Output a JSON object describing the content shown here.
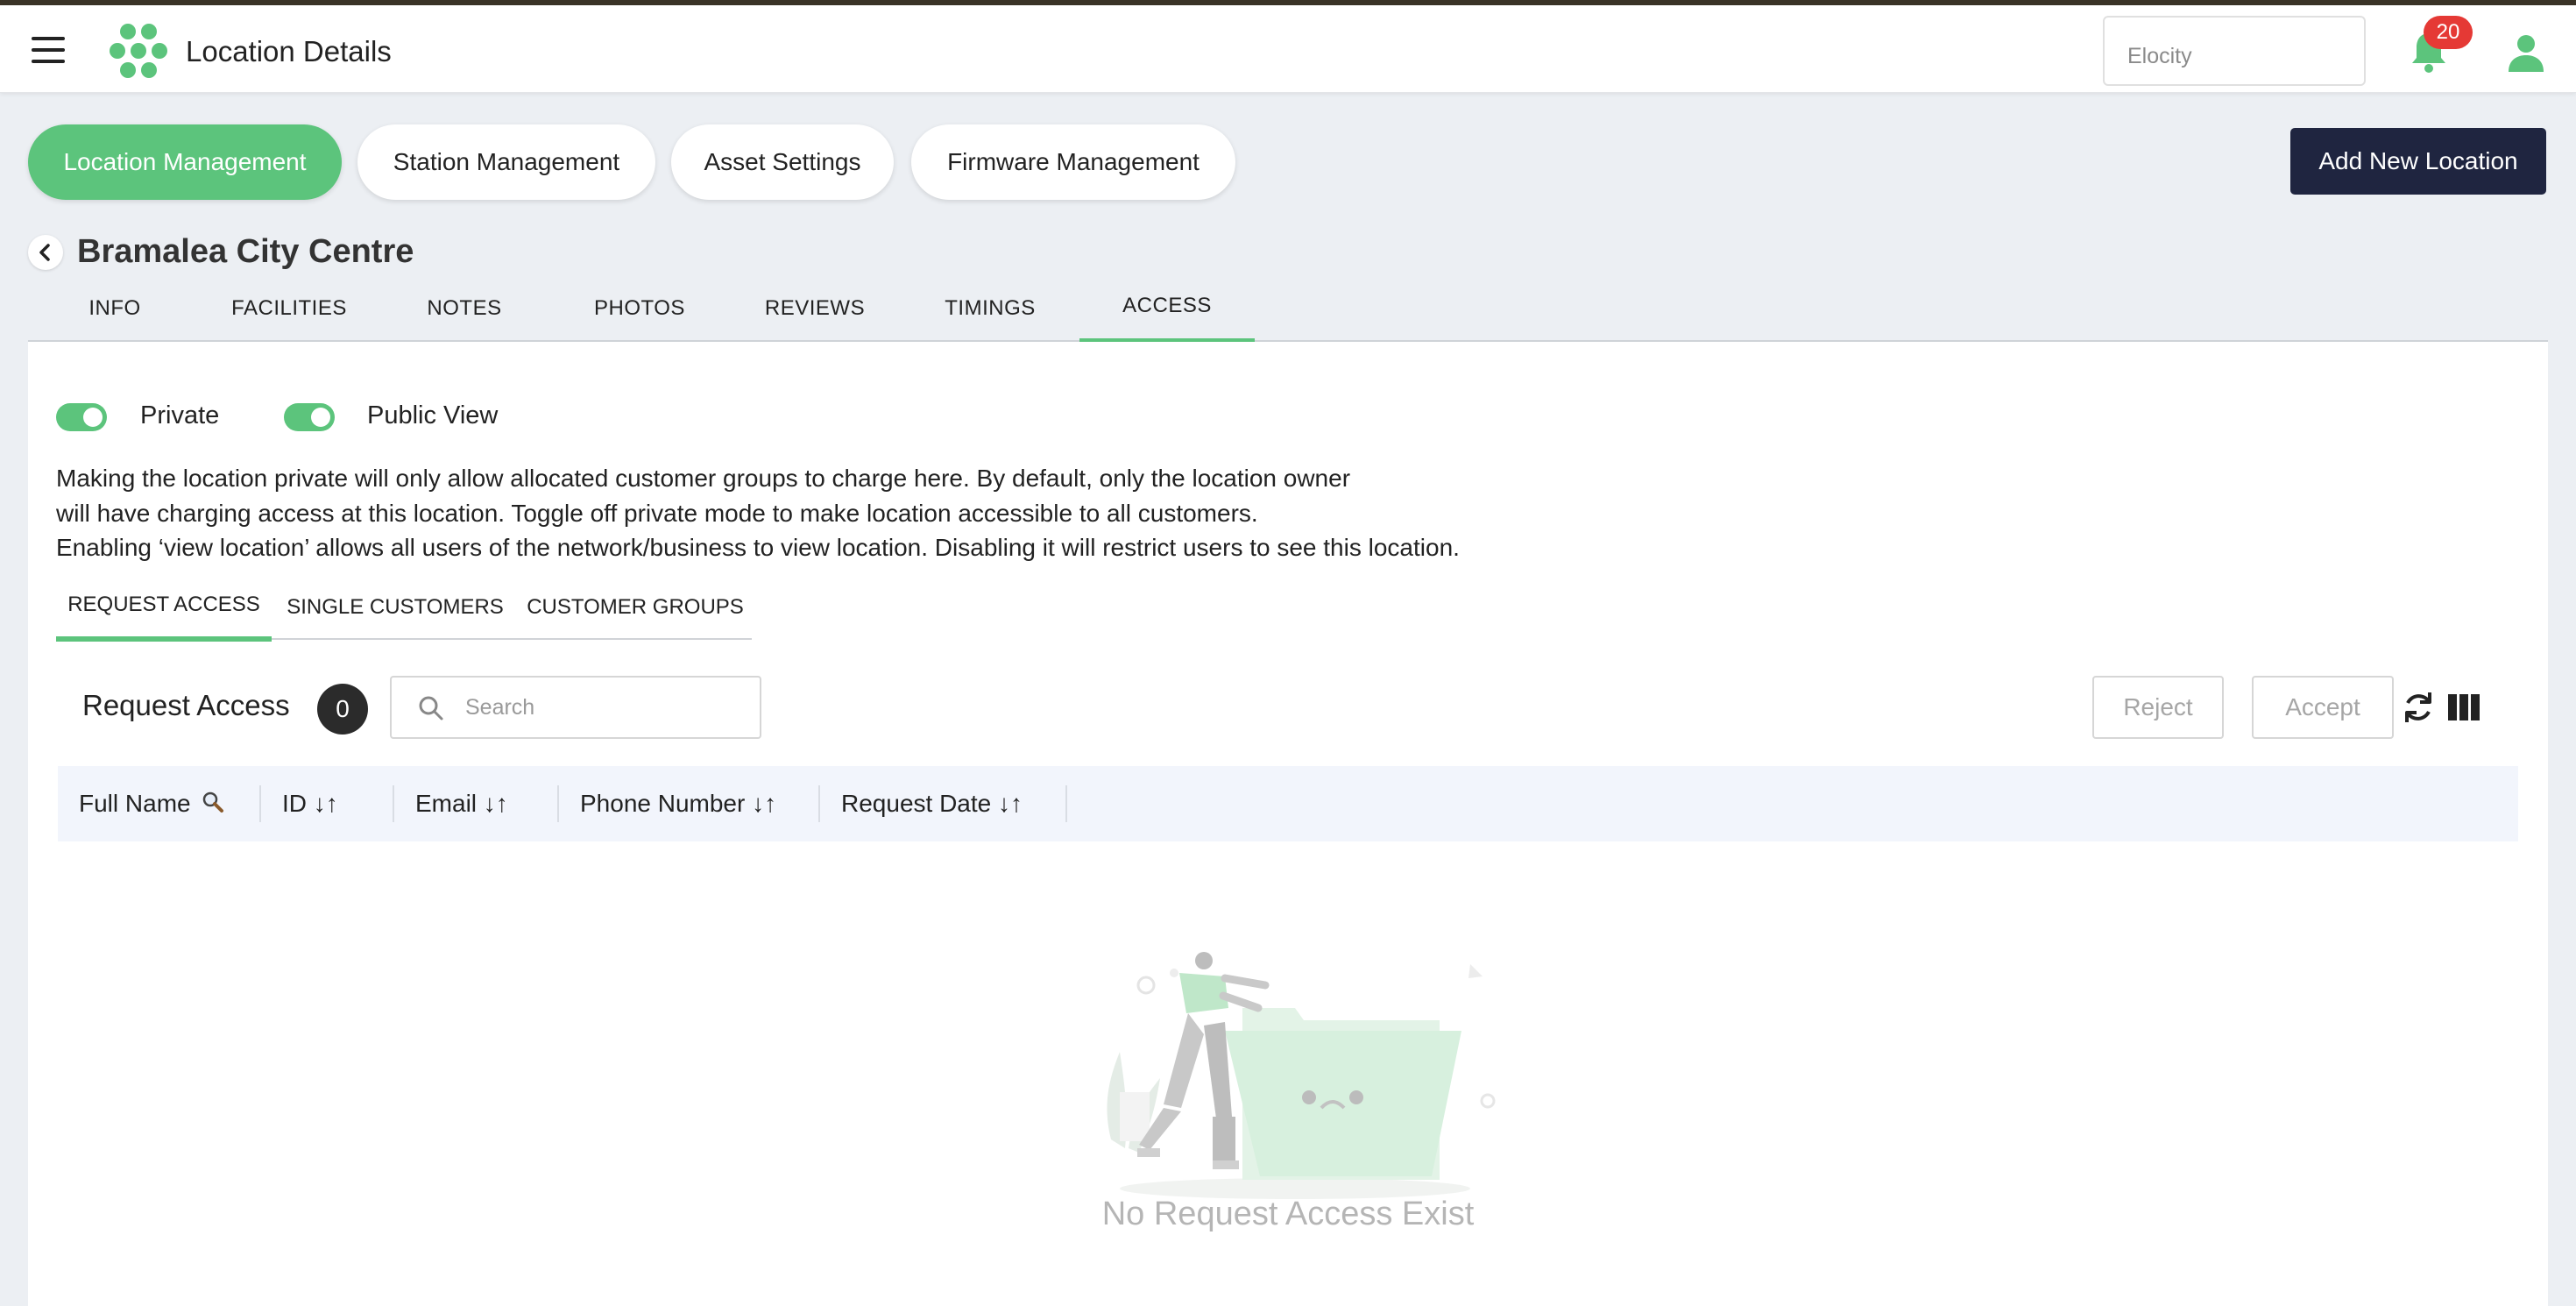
{
  "app": {
    "title": "Location Details",
    "org": "Elocity",
    "notifications": "20"
  },
  "nav_pills": [
    {
      "label": "Location Management",
      "active": true
    },
    {
      "label": "Station Management",
      "active": false
    },
    {
      "label": "Asset Settings",
      "active": false
    },
    {
      "label": "Firmware Management",
      "active": false
    }
  ],
  "add_button": "Add New Location",
  "location_name": "Bramalea City Centre",
  "tabs": [
    "INFO",
    "FACILITIES",
    "NOTES",
    "PHOTOS",
    "REVIEWS",
    "TIMINGS",
    "ACCESS"
  ],
  "active_tab": "ACCESS",
  "toggles": {
    "private": {
      "label": "Private",
      "on": true
    },
    "public_view": {
      "label": "Public View",
      "on": true
    }
  },
  "description": [
    "Making the location private will only allow allocated customer groups to charge here. By default, only the location owner",
    "will have charging access at this location. Toggle off private mode to make location accessible to all customers.",
    "Enabling ‘view location’ allows all users of the network/business to view location. Disabling it will restrict users to see this location."
  ],
  "subtabs": [
    "REQUEST ACCESS",
    "SINGLE CUSTOMERS",
    "CUSTOMER GROUPS"
  ],
  "active_subtab": "REQUEST ACCESS",
  "request_access": {
    "title": "Request Access",
    "count": "0",
    "search_placeholder": "Search",
    "reject_label": "Reject",
    "accept_label": "Accept",
    "columns": [
      {
        "label": "Full Name",
        "icon": "search-icon"
      },
      {
        "label": "ID ↓↑",
        "icon": "sort-icon"
      },
      {
        "label": "Email ↓↑",
        "icon": "sort-icon"
      },
      {
        "label": "Phone Number ↓↑",
        "icon": "sort-icon"
      },
      {
        "label": "Request Date ↓↑",
        "icon": "sort-icon"
      }
    ],
    "rows": [],
    "empty_message": "No Request Access Exist"
  },
  "colors": {
    "accent": "#5cc47c",
    "dark_button": "#1f2540",
    "badge": "#e53935"
  }
}
